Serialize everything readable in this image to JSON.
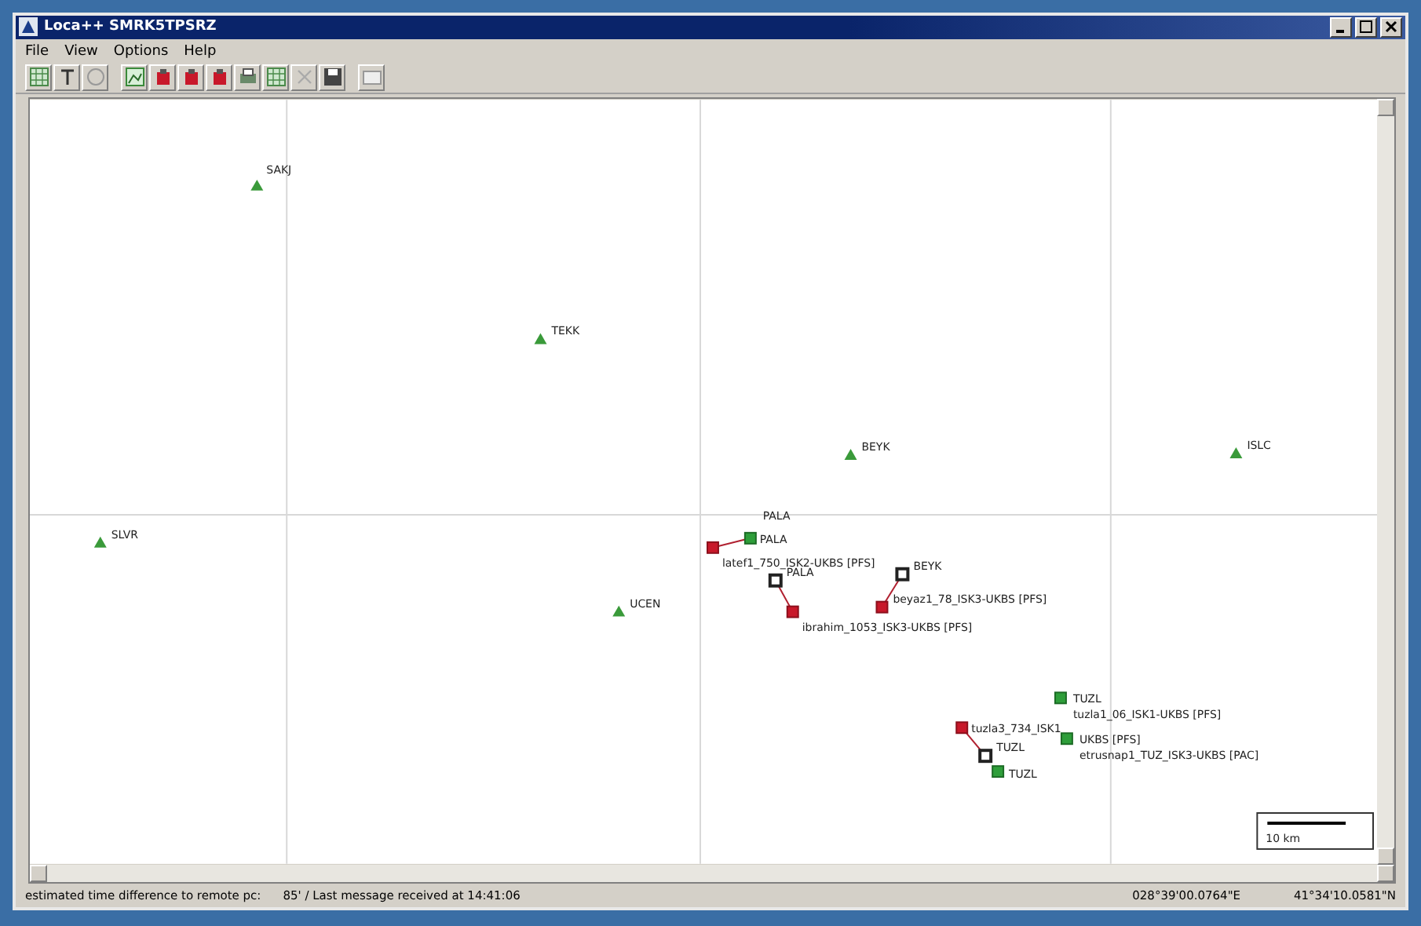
{
  "window": {
    "title": "Loca++ SMRK5TPSRZ"
  },
  "menu": [
    "File",
    "View",
    "Options",
    "Help"
  ],
  "toolbar": [
    {
      "kind": "grid"
    },
    {
      "kind": "text"
    },
    {
      "kind": "help"
    },
    {
      "kind": "map"
    },
    {
      "kind": "red"
    },
    {
      "kind": "red"
    },
    {
      "kind": "red"
    },
    {
      "kind": "print"
    },
    {
      "kind": "grid"
    },
    {
      "kind": "cross"
    },
    {
      "kind": "save"
    },
    {
      "kind": "window"
    }
  ],
  "map": {
    "nodes": [
      {
        "kind": "station",
        "labels": [
          "SAKJ"
        ]
      },
      {
        "kind": "station",
        "labels": [
          "TEKK"
        ]
      },
      {
        "kind": "station",
        "labels": [
          "BEYK"
        ]
      },
      {
        "kind": "station",
        "labels": [
          "ISLC"
        ]
      },
      {
        "kind": "station",
        "labels": [
          "SLVR"
        ]
      },
      {
        "kind": "station",
        "labels": [
          "UCEN"
        ]
      },
      {
        "kind": "green",
        "labels": [
          "PALA",
          "PALA"
        ]
      },
      {
        "kind": "red",
        "labels": [
          "latef1_750_ISK2-UKBS [PFS]"
        ]
      },
      {
        "kind": "open",
        "labels": [
          "PALA"
        ]
      },
      {
        "kind": "red",
        "labels": [
          "ibrahim_1053_ISK3-UKBS [PFS]"
        ]
      },
      {
        "kind": "open",
        "labels": [
          "BEYK"
        ]
      },
      {
        "kind": "red",
        "labels": [
          "beyaz1_78_ISK3-UKBS [PFS]"
        ]
      },
      {
        "kind": "green",
        "labels": [
          "TUZL",
          "tuzla1_06_ISK1-UKBS [PFS]"
        ]
      },
      {
        "kind": "red",
        "labels": [
          "tuzla3_734_ISK1"
        ]
      },
      {
        "kind": "open",
        "labels": [
          "TUZL"
        ]
      },
      {
        "kind": "green",
        "labels": [
          "UKBS [PFS]",
          "etrusnap1_TUZ_ISK3-UKBS [PAC]"
        ]
      },
      {
        "kind": "green",
        "labels": [
          "TUZL"
        ]
      }
    ],
    "scale": "10 km"
  },
  "status_bar": [
    "estimated time difference to remote pc:",
    "85' / Last message received at 14:41:06",
    "028°39'00.0764\"E",
    "41°34'10.0581\"N"
  ]
}
